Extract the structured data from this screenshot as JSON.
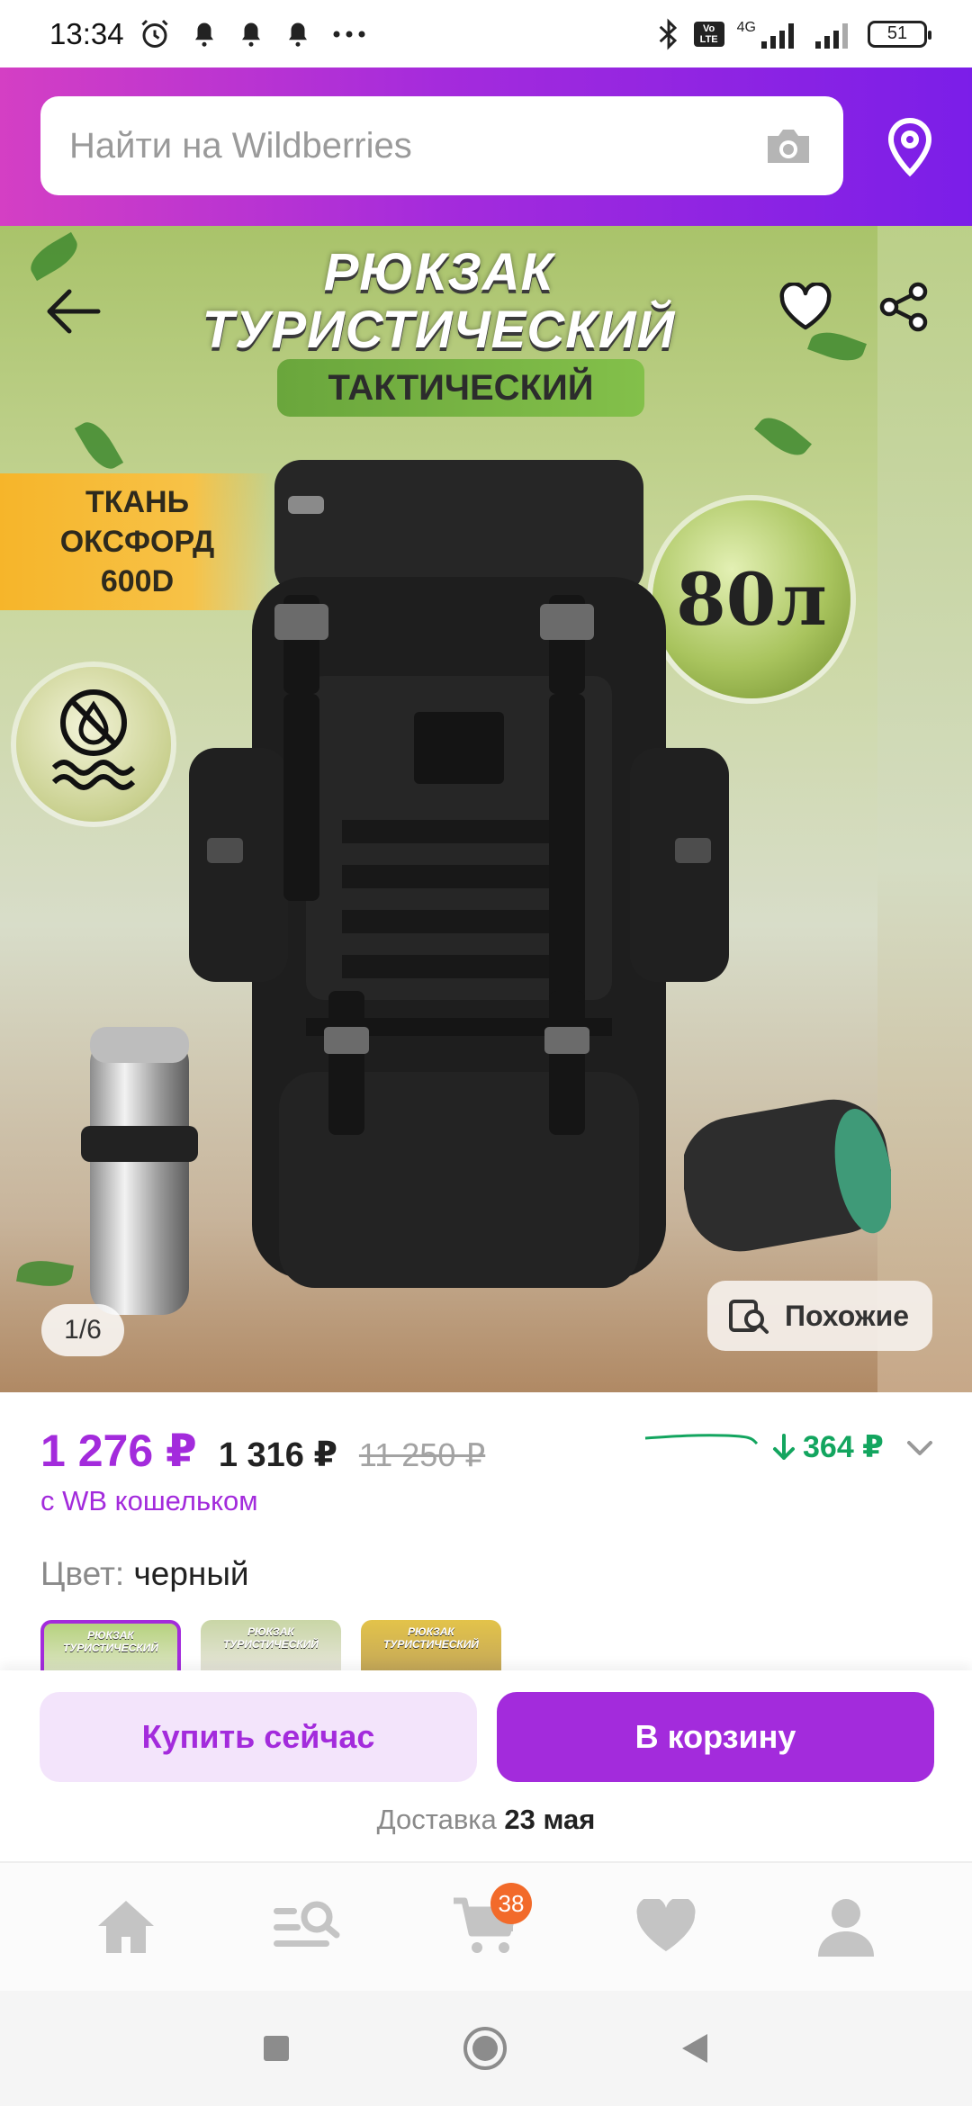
{
  "status_bar": {
    "time": "13:34",
    "battery": "51",
    "network": "4G",
    "volte": "Vo LTE",
    "icons": [
      "alarm-icon",
      "notification-bell-icon",
      "notification-bell-icon",
      "notification-bell-icon",
      "more-dots-icon",
      "bluetooth-icon",
      "signal-icon",
      "signal-icon",
      "battery-icon"
    ]
  },
  "search": {
    "placeholder": "Найти на Wildberries"
  },
  "product_image": {
    "title_line1": "РЮКЗАК",
    "title_line2": "ТУРИСТИЧЕСКИЙ",
    "tag": "ТАКТИЧЕСКИЙ",
    "oxford_line1": "ТКАНЬ",
    "oxford_line2": "ОКСФОРД",
    "oxford_line3": "600D",
    "volume": "80л",
    "page_indicator": "1/6",
    "similar_label": "Похожие"
  },
  "price": {
    "main": "1 276 ₽",
    "secondary": "1 316 ₽",
    "old": "11 250 ₽",
    "drop": "364 ₽",
    "wallet_note": "с WB кошельком"
  },
  "color": {
    "label": "Цвет:",
    "value": "черный",
    "variants": [
      {
        "text": "РЮКЗАК ТУРИСТИЧЕСКИЙ",
        "selected": true
      },
      {
        "text": "РЮКЗАК ТУРИСТИЧЕСКИЙ",
        "selected": false
      },
      {
        "text": "РЮКЗАК ТУРИСТИЧЕСКИЙ",
        "selected": false
      }
    ]
  },
  "actions": {
    "buy_now": "Купить сейчас",
    "add_to_cart": "В корзину",
    "delivery_label": "Доставка",
    "delivery_date": "23 мая"
  },
  "bottom_nav": {
    "cart_count": "38",
    "items": [
      "home-icon",
      "catalog-search-icon",
      "cart-icon",
      "favorites-icon",
      "profile-icon"
    ]
  },
  "colors": {
    "brand_purple": "#a32bdc",
    "header_gradient_start": "#d43fc4",
    "header_gradient_end": "#7b1ee8",
    "price_drop_green": "#13a55f",
    "badge_orange": "#f26a2a"
  }
}
